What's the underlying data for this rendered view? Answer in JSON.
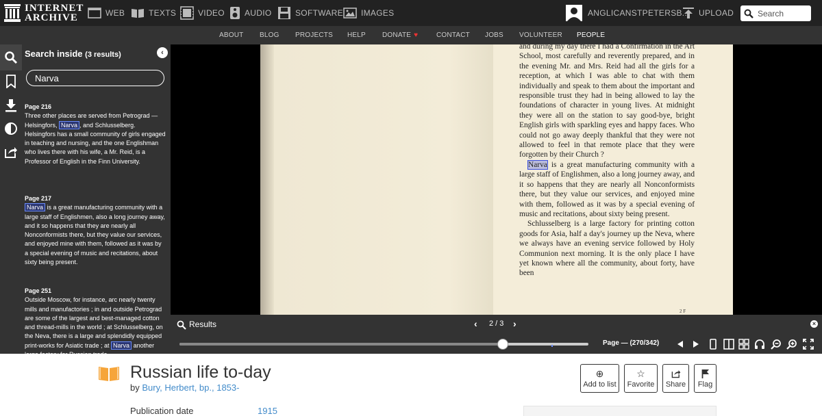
{
  "topnav": {
    "logo_line1": "INTERNET",
    "logo_line2": "ARCHIVE",
    "items": [
      "WEB",
      "TEXTS",
      "VIDEO",
      "AUDIO",
      "SOFTWARE",
      "IMAGES"
    ],
    "user": "ANGLICANSTPETERSB...",
    "upload": "UPLOAD",
    "search_placeholder": "Search"
  },
  "subnav": {
    "items": [
      "ABOUT",
      "BLOG",
      "PROJECTS",
      "HELP",
      "DONATE",
      "CONTACT",
      "JOBS",
      "VOLUNTEER",
      "PEOPLE"
    ],
    "active": "PEOPLE",
    "donate_heart": "♥"
  },
  "search_panel": {
    "title": "Search inside",
    "count": "(3 results)",
    "query": "Narva",
    "results": [
      {
        "page": "Page 216",
        "before": "Three other places are served from Petrograd — Helsingfors, ",
        "match": "Narva",
        "after": ", and Schlusselberg. Helsingfors has a small community of girls engaged in teaching and nursing, and the one Englishman who lives there with his wife, a Mr. Reid, is a Professor of English in the Finn University."
      },
      {
        "page": "Page 217",
        "before": "",
        "match": "Narva",
        "after": " is a great manufacturing community with a large staff of Englishmen, also a long journey away, and it so happens that they are nearly all Nonconformists there, but they value our services, and enjoyed mine with them, followed as it was by a special evening of music and recitations, about sixty being present."
      },
      {
        "page": "Page 251",
        "before": "Outside Moscow, for instance, arc nearly twenty mills and manufactories ; in and outside Petrograd are some of the largest and best-managed cotton and thread-mills in the world ; at Schlusselberg, on the Neva, there is a large and splendidly equipped print-works for Asiatic trade ; at ",
        "match": "Narva",
        "after": " another large factory for Russian trade"
      }
    ]
  },
  "book_page": {
    "para1": "and during my day there I had a Confirmation in the Art School, most carefully and reverently prepared, and in the evening Mr. and Mrs. Reid had all the girls for a reception, at which I was able to chat with them individually and speak to them about the important and responsible trust they had in being allowed to lay the foundations of character in young lives. At midnight they were all on the station to say good-bye, bright English girls with sparkling eyes and happy faces. Who could not go away deeply thankful that they were not allowed to feel in that remote place that they were forgotten by their Church ?",
    "para2_match": "Narva",
    "para2_rest": " is a great manufacturing community with a large staff of Englishmen, also a long journey away, and it so happens that they are nearly all Nonconformists there, but they value our services, and enjoyed mine with them, followed as it was by a special evening of music and recitations, about sixty being present.",
    "para3": "Schlusselberg is a large factory for printing cotton goods for Asia, half a day's journey up the Neva, where we always have an evening service followed by Holy Communion next morning. It is the only place I have yet known where all the community, about forty, have been",
    "signature": "2 F"
  },
  "results_bar": {
    "label": "Results",
    "pager": "2 / 3"
  },
  "toolbar": {
    "page_readout": "Page — (270/342)",
    "progress": 0.79
  },
  "item": {
    "title": "Russian life to-day",
    "by": "by",
    "author": "Bury, Herbert, bp., 1853-",
    "pub_label": "Publication date",
    "pub_value": "1915",
    "actions": [
      "Add to list",
      "Favorite",
      "Share",
      "Flag"
    ]
  }
}
